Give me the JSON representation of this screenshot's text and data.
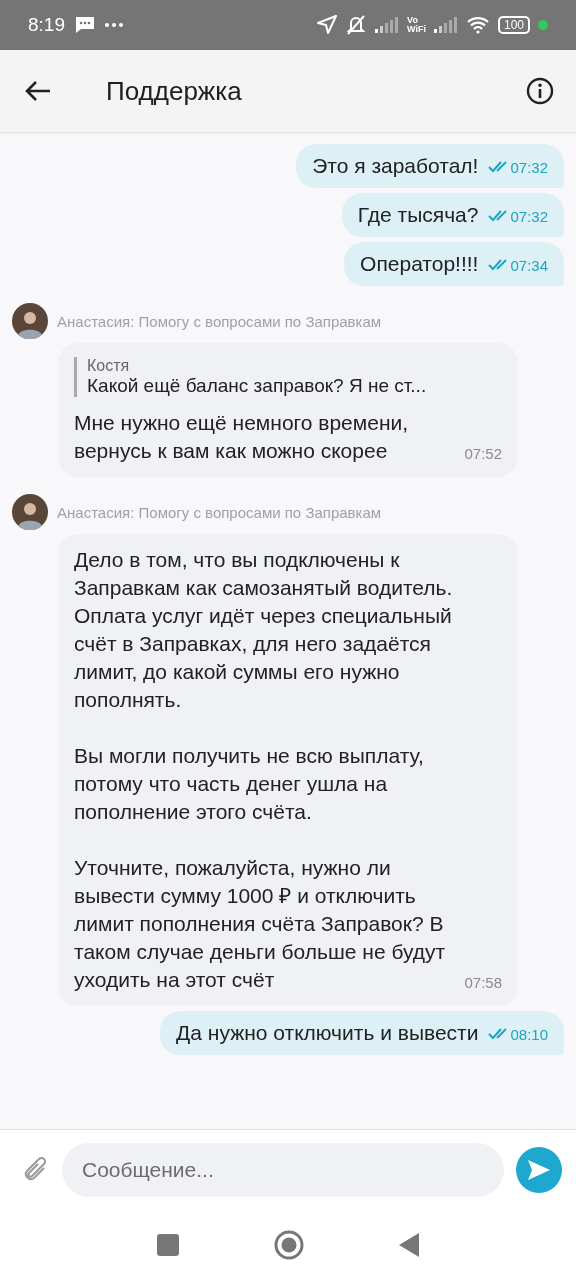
{
  "status_bar": {
    "time": "8:19",
    "vowifi": [
      "Vo",
      "WiFi"
    ],
    "battery": "100"
  },
  "header": {
    "title": "Поддержка"
  },
  "messages": [
    {
      "kind": "outgoing",
      "text": "Это я заработал!",
      "time": "07:32",
      "read": true
    },
    {
      "kind": "outgoing",
      "text": "Где тысяча?",
      "time": "07:32",
      "read": true
    },
    {
      "kind": "outgoing",
      "text": "Оператор!!!!",
      "time": "07:34",
      "read": true
    },
    {
      "kind": "incoming",
      "sender": "Анастасия: Помогу с вопросами по Заправкам",
      "quote": {
        "author": "Костя",
        "text": "Какой ещё баланс заправок? Я не ст..."
      },
      "text": "Мне нужно ещё немного времени, вернусь к вам как можно скорее",
      "time": "07:52"
    },
    {
      "kind": "incoming",
      "sender": "Анастасия: Помогу с вопросами по Заправкам",
      "text": "Дело в том, что вы подключены к Заправкам как самозанятый водитель. Оплата услуг идёт через специальный счёт в Заправках, для него задаётся лимит, до какой суммы его нужно пополнять.\n\nВы могли получить не всю выплату, потому что часть денег ушла на пополнение этого счёта.\n\nУточните, пожалуйста, нужно ли вывести сумму 1000 ₽ и отключить лимит пополнения счёта Заправок? В таком случае деньги больше не будут уходить на этот счёт",
      "time": "07:58"
    },
    {
      "kind": "outgoing",
      "text": "Да нужно отключить и вывести",
      "time": "08:10",
      "read": true
    }
  ],
  "composer": {
    "placeholder": "Сообщение..."
  }
}
